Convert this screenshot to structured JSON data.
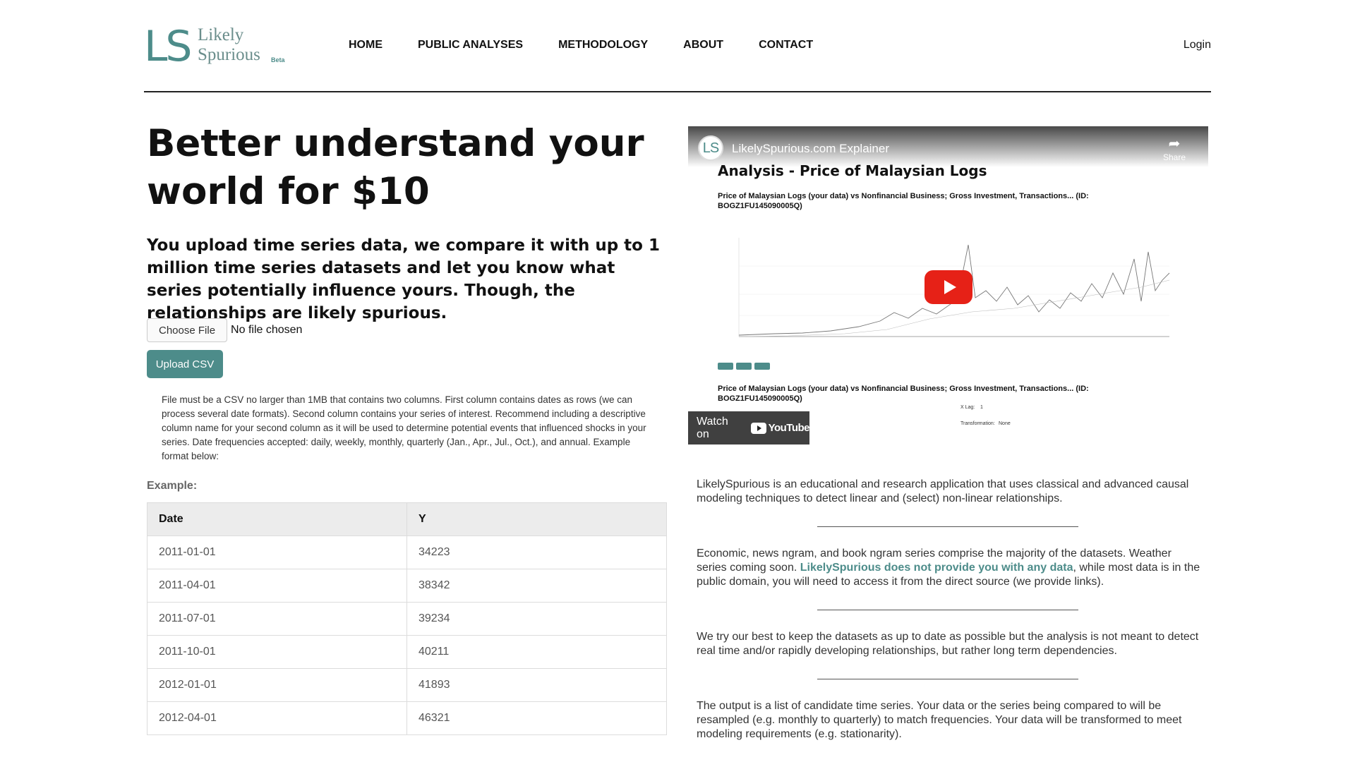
{
  "header": {
    "logo": {
      "mark": "LS",
      "line1": "Likely",
      "line2": "Spurious",
      "badge": "Beta"
    },
    "nav": [
      "HOME",
      "PUBLIC ANALYSES",
      "METHODOLOGY",
      "ABOUT",
      "CONTACT"
    ],
    "login": "Login"
  },
  "hero": {
    "title": "Better understand your world for $10",
    "subtitle": "You upload time series data, we compare it with up to 1 million time series datasets and let you know what series potentially influence yours. Though, the relationships are likely spurious."
  },
  "upload": {
    "choose_label": "Choose File",
    "no_file": "No file chosen",
    "upload_label": "Upload CSV",
    "help": "File must be a CSV no larger than 1MB that contains two columns. First column contains dates as rows (we can process several date formats). Second column contains your series of interest. Recommend including a descriptive column name for your second column as it will be used to determine potential events that influenced shocks in your series. Date frequencies accepted: daily, weekly, monthly, quarterly (Jan., Apr., Jul., Oct.), and annual. Example format below:"
  },
  "example": {
    "label": "Example:",
    "headers": [
      "Date",
      "Y"
    ],
    "rows": [
      [
        "2011-01-01",
        "34223"
      ],
      [
        "2011-04-01",
        "38342"
      ],
      [
        "2011-07-01",
        "39234"
      ],
      [
        "2011-10-01",
        "40211"
      ],
      [
        "2012-01-01",
        "41893"
      ],
      [
        "2012-04-01",
        "46321"
      ]
    ]
  },
  "video": {
    "channel_mark": "LS",
    "title": "LikelySpurious.com Explainer",
    "share": "Share",
    "slide_title": "Analysis - Price of Malaysian Logs",
    "slide_caption": "Price of Malaysian Logs (your data) vs Nonfinancial Business; Gross Investment, Transactions... (ID: BOGZ1FU145090005Q)",
    "slide_caption2": "Price of Malaysian Logs (your data) vs Nonfinancial Business; Gross Investment, Transactions... (ID: BOGZ1FU145090005Q)",
    "x_lag_label": "X Lag:",
    "x_lag_value": "1",
    "transformation_label": "Transformation:",
    "transformation_value": "None",
    "watch_on": "Watch on",
    "youtube": "YouTube",
    "accent": "#e62117"
  },
  "about": {
    "p1": "LikelySpurious is an educational and research application that uses classical and advanced causal modeling techniques to detect linear and (select) non-linear relationships.",
    "p2_before": "Economic, news ngram, and book ngram series comprise the majority of the datasets. Weather series coming soon. ",
    "p2_link": "LikelySpurious does not provide you with any data",
    "p2_after": ", while most data is in the public domain, you will need to access it from the direct source (we provide links).",
    "p3": "We try our best to keep the datasets as up to date as possible but the analysis is not meant to detect real time and/or rapidly developing relationships, but rather long term dependencies.",
    "p4": "The output is a list of candidate time series. Your data or the series being compared to will be resampled (e.g. monthly to quarterly) to match frequencies. Your data will be transformed to meet modeling requirements (e.g. stationarity)."
  },
  "colors": {
    "brand": "#4d8c8a"
  }
}
